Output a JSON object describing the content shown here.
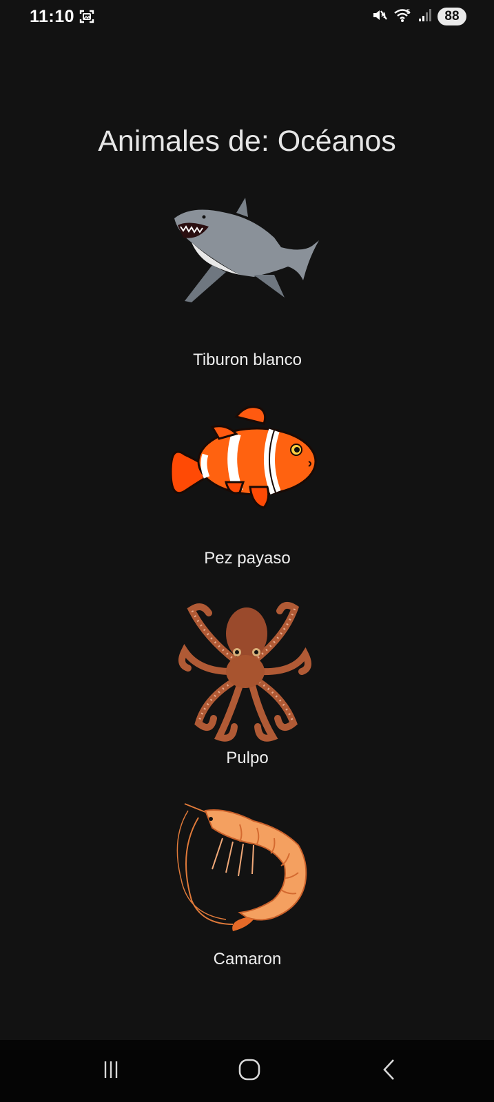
{
  "status_bar": {
    "time": "11:10",
    "battery": "88",
    "icons": [
      "screenshot-icon",
      "mute-icon",
      "wifi-icon",
      "signal-icon"
    ]
  },
  "page": {
    "title": "Animales de: Océanos"
  },
  "animals": [
    {
      "name": "Tiburon blanco",
      "icon": "shark-image"
    },
    {
      "name": "Pez payaso",
      "icon": "clownfish-image"
    },
    {
      "name": "Pulpo",
      "icon": "octopus-image"
    },
    {
      "name": "Camaron",
      "icon": "shrimp-image"
    }
  ],
  "nav_bar": {
    "buttons": [
      "recent-apps-icon",
      "home-icon",
      "back-icon"
    ]
  },
  "colors": {
    "background": "#121212",
    "text": "#f0f0f0",
    "nav_background": "#050505"
  }
}
